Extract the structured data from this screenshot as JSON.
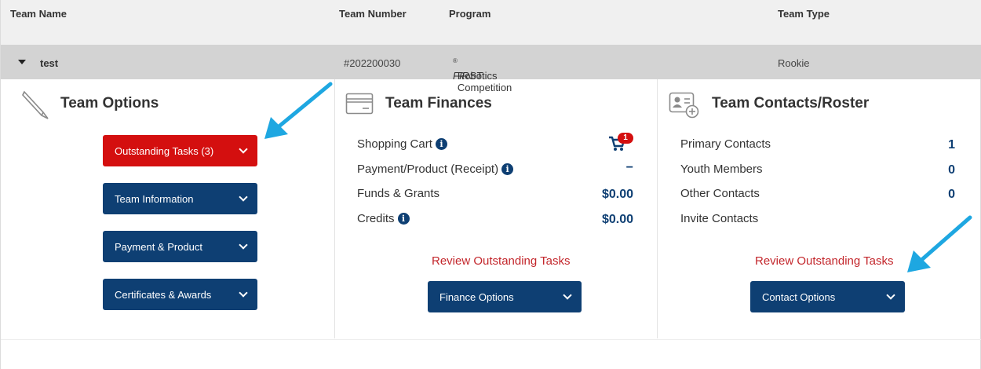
{
  "header": {
    "team_name": "Team Name",
    "team_number": "Team Number",
    "program": "Program",
    "team_type": "Team Type"
  },
  "team": {
    "name": "test",
    "number": "#202200030",
    "program_first": "FIRST",
    "program_reg": "®",
    "program_rest": " Robotics Competition",
    "type": "Rookie"
  },
  "team_options": {
    "title": "Team Options",
    "buttons": [
      {
        "label": "Outstanding Tasks (3)",
        "color": "#d40f0f"
      },
      {
        "label": "Team Information",
        "color": "#0e3f73"
      },
      {
        "label": "Payment & Product",
        "color": "#0e3f73"
      },
      {
        "label": "Certificates & Awards",
        "color": "#0e3f73"
      }
    ]
  },
  "team_finances": {
    "title": "Team Finances",
    "rows": [
      {
        "label": "Shopping Cart",
        "value": "",
        "info_icon": true
      },
      {
        "label": "Payment/Product (Receipt)",
        "value": "−",
        "info_icon": true
      },
      {
        "label": "Funds & Grants",
        "value": "$0.00",
        "info_icon": false
      },
      {
        "label": "Credits",
        "value": "$0.00",
        "info_icon": true
      }
    ],
    "cart_count": "1",
    "review_link": "Review Outstanding Tasks",
    "options_button": "Finance Options"
  },
  "team_contacts": {
    "title": "Team Contacts/Roster",
    "rows": [
      {
        "label": "Primary Contacts",
        "value": "1"
      },
      {
        "label": "Youth Members",
        "value": "0"
      },
      {
        "label": "Other Contacts",
        "value": "0"
      },
      {
        "label": "Invite Contacts",
        "value": ""
      }
    ],
    "review_link": "Review Outstanding Tasks",
    "options_button": "Contact Options"
  },
  "colors": {
    "primary_blue": "#0e3f73",
    "alert_red": "#d40f0f",
    "link_red": "#c3262b",
    "annotation_arrow": "#1ea7e1"
  },
  "icons": [
    "pencil-icon",
    "credit-card-icon",
    "contact-card-icon",
    "shopping-cart-icon",
    "info-icon",
    "chevron-down-icon",
    "caret-down-icon",
    "arrow-annotation-icon"
  ]
}
